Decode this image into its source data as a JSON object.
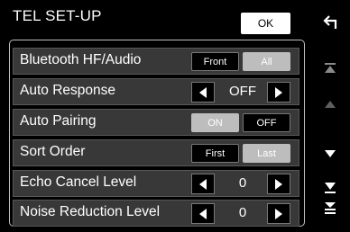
{
  "header": {
    "title": "TEL SET-UP",
    "ok_label": "OK",
    "back_icon": "return-arrow-icon"
  },
  "settings": [
    {
      "label": "Bluetooth HF/Audio",
      "type": "toggle",
      "options": [
        "Front",
        "All"
      ],
      "selected": "All"
    },
    {
      "label": "Auto Response",
      "type": "stepper",
      "value": "OFF"
    },
    {
      "label": "Auto Pairing",
      "type": "toggle",
      "options": [
        "ON",
        "OFF"
      ],
      "selected": "ON"
    },
    {
      "label": "Sort Order",
      "type": "toggle",
      "options": [
        "First",
        "Last"
      ],
      "selected": "Last"
    },
    {
      "label": "Echo Cancel Level",
      "type": "stepper",
      "value": "0"
    },
    {
      "label": "Noise Reduction Level",
      "type": "stepper",
      "value": "0"
    }
  ],
  "scrollbar": {
    "icons": [
      "page-top-icon",
      "scroll-up-icon",
      "scroll-down-icon",
      "page-down-icon",
      "page-bottom-icon"
    ]
  },
  "colors": {
    "background": "#000000",
    "row_background": "#383838",
    "selected_option": "#bdbdbd",
    "frame_border": "#bfbfbf"
  }
}
